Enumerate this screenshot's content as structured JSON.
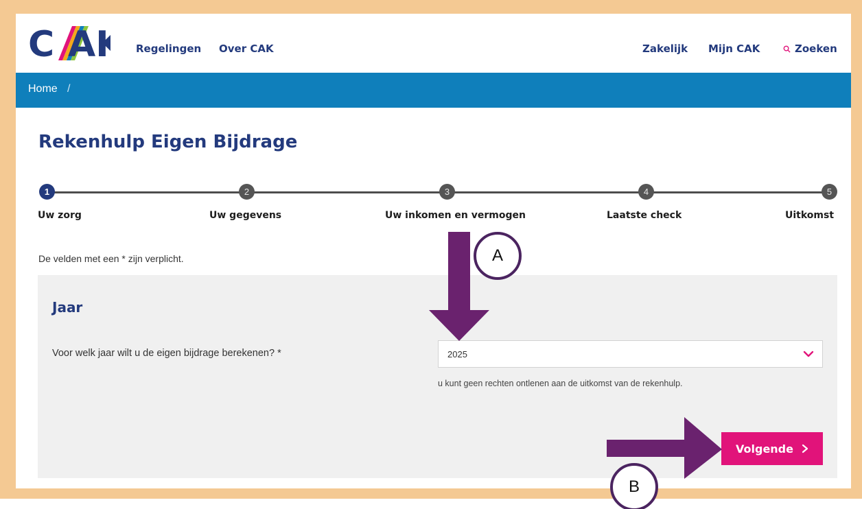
{
  "header": {
    "logo_text": "C/AK",
    "nav_left": [
      "Regelingen",
      "Over CAK"
    ],
    "nav_right": [
      "Zakelijk",
      "Mijn CAK"
    ],
    "search_label": "Zoeken"
  },
  "breadcrumb": {
    "home": "Home",
    "separator": "/"
  },
  "page_title": "Rekenhulp Eigen Bijdrage",
  "steps": [
    {
      "number": "1",
      "label": "Uw zorg",
      "active": true
    },
    {
      "number": "2",
      "label": "Uw gegevens",
      "active": false
    },
    {
      "number": "3",
      "label": "Uw inkomen en vermogen",
      "active": false
    },
    {
      "number": "4",
      "label": "Laatste check",
      "active": false
    },
    {
      "number": "5",
      "label": "Uitkomst",
      "active": false
    }
  ],
  "required_note": "De velden met een * zijn verplicht.",
  "form": {
    "section_title": "Jaar",
    "question_label": "Voor welk jaar wilt u de eigen bijdrage berekenen? *",
    "year_value": "2025",
    "helper_text": "u kunt geen rechten ontlenen aan de uitkomst van de rekenhulp.",
    "next_button": "Volgende"
  },
  "annotations": {
    "a_label": "A",
    "b_label": "B"
  },
  "colors": {
    "frame": "#f4c993",
    "brand_navy": "#233a7d",
    "breadcrumb_bar": "#0f7fbb",
    "accent_pink": "#e1137a",
    "annotation_purple": "#6a226e"
  }
}
